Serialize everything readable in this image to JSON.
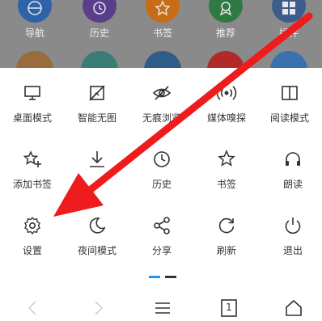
{
  "quick_links": [
    {
      "label": "导航",
      "icon": "globe-icon",
      "color": "#2f63a8"
    },
    {
      "label": "历史",
      "icon": "history-clock-icon",
      "color": "#5a3e8c"
    },
    {
      "label": "书签",
      "icon": "star-icon",
      "color": "#c76d16"
    },
    {
      "label": "推荐",
      "icon": "badge-icon",
      "color": "#2f7a42"
    },
    {
      "label": "插件",
      "icon": "grid-icon",
      "color": "#3c5d8c"
    }
  ],
  "menu": {
    "row1": [
      {
        "label": "桌面模式",
        "icon": "desktop-icon"
      },
      {
        "label": "智能无图",
        "icon": "no-image-icon"
      },
      {
        "label": "无痕浏览",
        "icon": "incognito-eye-icon"
      },
      {
        "label": "媒体嗅探",
        "icon": "media-sniff-icon"
      },
      {
        "label": "阅读模式",
        "icon": "reading-mode-icon"
      }
    ],
    "row2": [
      {
        "label": "添加书签",
        "icon": "add-bookmark-icon"
      },
      {
        "label": "",
        "icon": "download-icon"
      },
      {
        "label": "历史",
        "icon": "clock-icon"
      },
      {
        "label": "书签",
        "icon": "bookmark-star-icon"
      },
      {
        "label": "朗读",
        "icon": "headphones-icon"
      }
    ],
    "row3": [
      {
        "label": "设置",
        "icon": "gear-icon"
      },
      {
        "label": "夜间模式",
        "icon": "moon-icon"
      },
      {
        "label": "分享",
        "icon": "share-icon"
      },
      {
        "label": "刷新",
        "icon": "refresh-icon"
      },
      {
        "label": "退出",
        "icon": "power-icon"
      }
    ]
  },
  "pager": {
    "pages": 2,
    "active": 1,
    "active_color": "#2196f3",
    "inactive_color": "#333333"
  },
  "navbar": {
    "tab_count": "1"
  },
  "colors": {
    "accent_arrow": "#ee1c1c",
    "icon_stroke": "#333333"
  }
}
